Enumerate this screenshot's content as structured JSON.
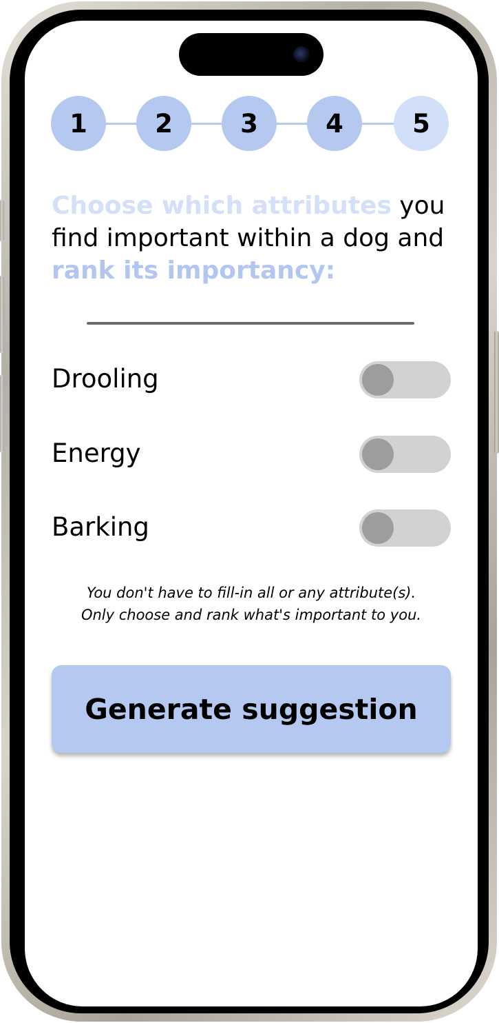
{
  "stepper": {
    "steps": [
      "1",
      "2",
      "3",
      "4",
      "5"
    ],
    "current_step": 5
  },
  "heading": {
    "part1_highlight": "Choose which attributes",
    "part2": " you find important within a dog and ",
    "part3_highlight": "rank its importancy:"
  },
  "attributes": [
    {
      "label": "Drooling",
      "enabled": false
    },
    {
      "label": "Energy",
      "enabled": false
    },
    {
      "label": "Barking",
      "enabled": false
    }
  ],
  "hint": {
    "line1": "You don't have to fill-in all or any attribute(s).",
    "line2": "Only choose and rank what's important to you."
  },
  "generate_button": {
    "label": "Generate suggestion"
  },
  "colors": {
    "accent": "#b4c8f0",
    "accent_light": "#d2dff8",
    "toggle_track": "#d2d2d2",
    "toggle_knob": "#9d9d9d"
  }
}
